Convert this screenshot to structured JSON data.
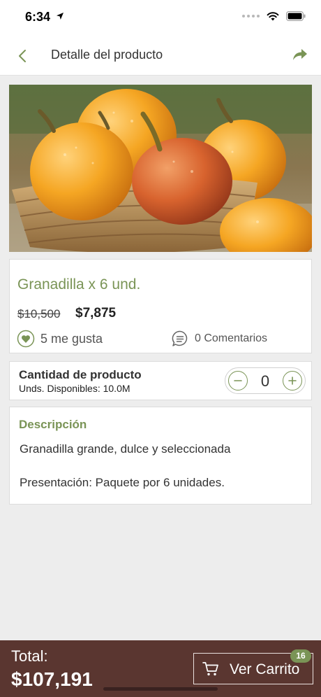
{
  "status_bar": {
    "time": "6:34"
  },
  "nav": {
    "title": "Detalle del producto",
    "back_icon": "chevron-left-icon",
    "share_icon": "share-arrow-icon"
  },
  "product": {
    "name": "Granadilla x 6 und.",
    "old_price": "$10,500",
    "price": "$7,875",
    "likes": "5 me gusta",
    "comments": "0 Comentarios"
  },
  "quantity": {
    "title": "Cantidad de producto",
    "available": "Unds. Disponibles: 10.0M",
    "value": "0"
  },
  "description": {
    "title": "Descripción",
    "line1": "Granadilla grande, dulce y seleccionada",
    "line2": "Presentación: Paquete por 6 unidades."
  },
  "footer": {
    "total_label": "Total:",
    "total_value": "$107,191",
    "cart_label": "Ver Carrito",
    "cart_badge": "16"
  },
  "colors": {
    "accent": "#7a9456",
    "footer_bg": "#5a3630",
    "page_bg": "#ededed"
  }
}
